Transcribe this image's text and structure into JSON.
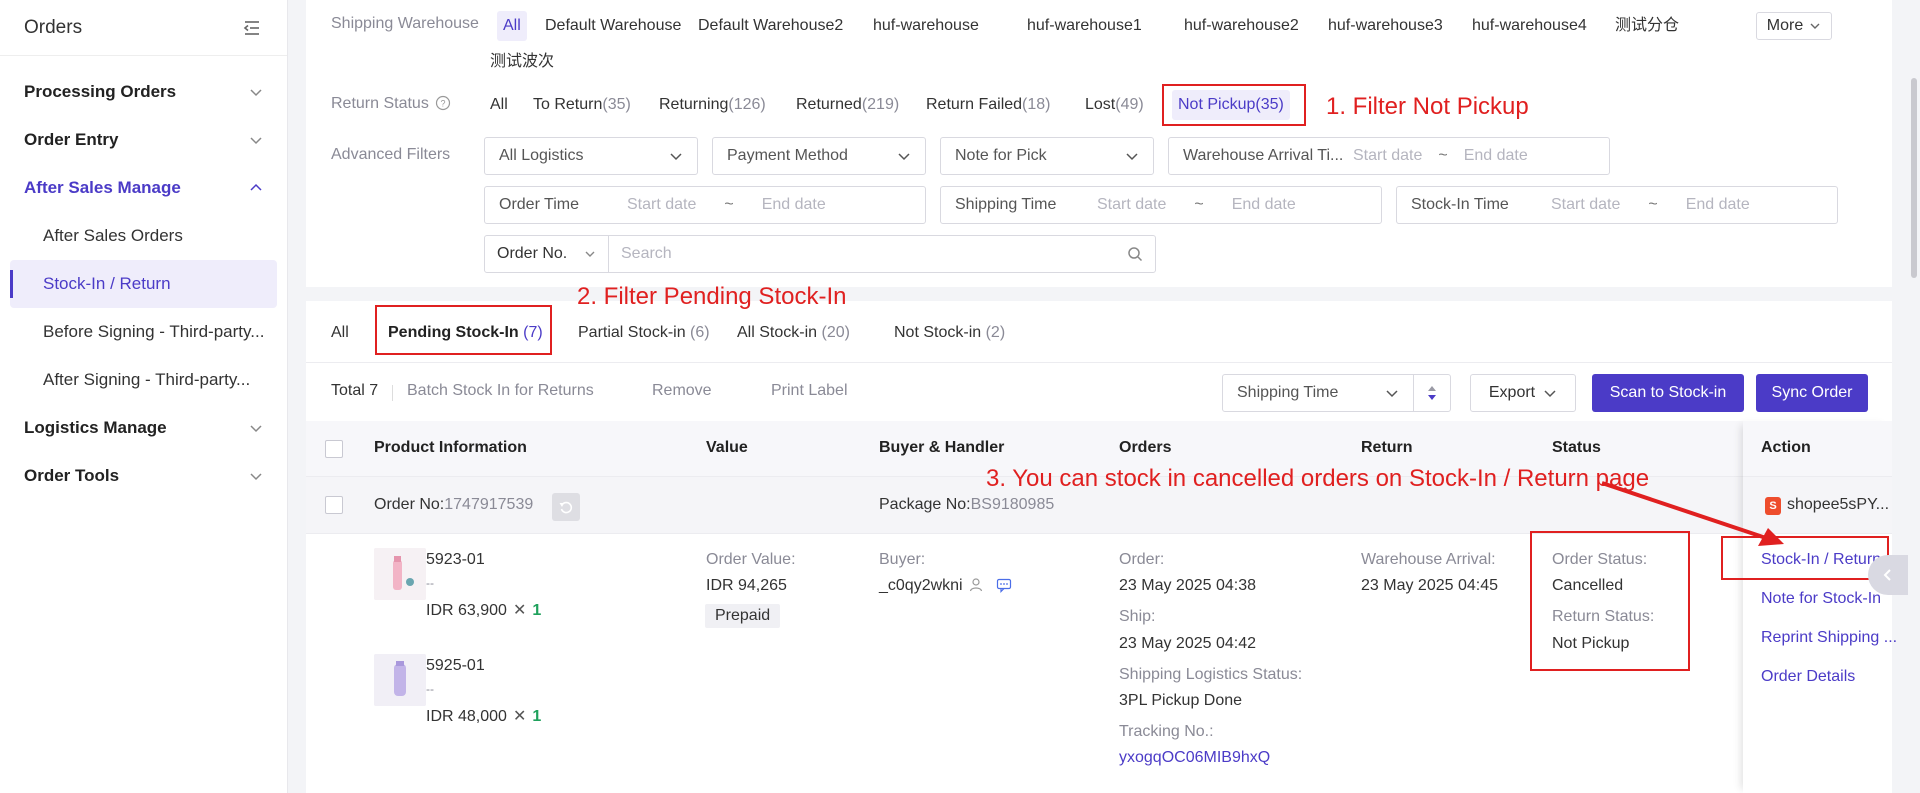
{
  "sidebar": {
    "title": "Orders",
    "groups": [
      {
        "label": "Processing Orders"
      },
      {
        "label": "Order Entry"
      },
      {
        "label": "After Sales Manage"
      },
      {
        "label": "Logistics Manage"
      },
      {
        "label": "Order Tools"
      }
    ],
    "subitems": [
      {
        "label": "After Sales Orders"
      },
      {
        "label": "Stock-In / Return"
      },
      {
        "label": "Before Signing - Third-party..."
      },
      {
        "label": "After Signing - Third-party..."
      }
    ]
  },
  "filters": {
    "warehouse_label": "Shipping Warehouse",
    "warehouses": [
      "All",
      "Default Warehouse",
      "Default Warehouse2",
      "huf-warehouse",
      "huf-warehouse1",
      "huf-warehouse2",
      "huf-warehouse3",
      "huf-warehouse4",
      "测试分仓",
      "测试波次"
    ],
    "more_label": "More",
    "return_status_label": "Return Status",
    "return_statuses": [
      {
        "label": "All",
        "count": ""
      },
      {
        "label": "To Return",
        "count": "(35)"
      },
      {
        "label": "Returning",
        "count": "(126)"
      },
      {
        "label": "Returned",
        "count": "(219)"
      },
      {
        "label": "Return Failed",
        "count": "(18)"
      },
      {
        "label": "Lost",
        "count": "(49)"
      },
      {
        "label": "Not Pickup",
        "count": "(35)"
      }
    ],
    "advanced_label": "Advanced Filters",
    "selects": {
      "logistics": "All Logistics",
      "payment": "Payment Method",
      "note": "Note for Pick"
    },
    "ranges": {
      "warehouse_arrival": "Warehouse Arrival Ti...",
      "order_time": "Order Time",
      "shipping_time": "Shipping Time",
      "stock_in_time": "Stock-In Time",
      "start_placeholder": "Start date",
      "end_placeholder": "End date",
      "separator": "~"
    },
    "search": {
      "type": "Order No.",
      "placeholder": "Search"
    }
  },
  "tabs": [
    {
      "label": "All",
      "count": ""
    },
    {
      "label": "Pending Stock-In",
      "count": "(7)"
    },
    {
      "label": "Partial Stock-in",
      "count": "(6)"
    },
    {
      "label": "All Stock-in",
      "count": "(20)"
    },
    {
      "label": "Not Stock-in",
      "count": "(2)"
    }
  ],
  "toolbar": {
    "total": "Total 7",
    "batch_stock_in": "Batch Stock In for Returns",
    "remove": "Remove",
    "print_label": "Print Label",
    "sort_field": "Shipping Time",
    "export": "Export",
    "scan": "Scan to Stock-in",
    "sync": "Sync Order"
  },
  "columns": {
    "product": "Product Information",
    "value": "Value",
    "buyer": "Buyer & Handler",
    "orders": "Orders",
    "return": "Return",
    "status": "Status",
    "action": "Action"
  },
  "order": {
    "order_no_label": "Order No:",
    "order_no": "1747917539",
    "package_label": "Package No:",
    "package_no": "BS9180985",
    "shop": "shopee5sPY...",
    "products": [
      {
        "sku": "5923-01",
        "sub": "--",
        "price": "IDR 63,900",
        "qty": "1"
      },
      {
        "sku": "5925-01",
        "sub": "--",
        "price": "IDR 48,000",
        "qty": "1"
      }
    ],
    "order_value_label": "Order Value:",
    "order_value": "IDR 94,265",
    "payment_badge": "Prepaid",
    "buyer_label": "Buyer:",
    "buyer": "_c0qy2wkni",
    "order_label": "Order:",
    "order_time": "23 May 2025 04:38",
    "ship_label": "Ship:",
    "ship_time": "23 May 2025 04:42",
    "logistics_status_label": "Shipping Logistics Status:",
    "logistics_status": "3PL Pickup Done",
    "tracking_label": "Tracking No.:",
    "tracking_no": "yxogqOC06MIB9hxQ",
    "warehouse_arrival_label": "Warehouse Arrival:",
    "warehouse_arrival": "23 May 2025 04:45",
    "order_status_label": "Order Status:",
    "order_status": "Cancelled",
    "return_status_label": "Return Status:",
    "return_status": "Not Pickup",
    "actions": [
      "Stock-In / Return",
      "Note for Stock-In",
      "Reprint Shipping ...",
      "Order Details"
    ]
  },
  "annotations": {
    "step1": "1. Filter Not Pickup",
    "step2": "2. Filter Pending Stock-In",
    "step3": "3. You can stock in cancelled orders on Stock-In / Return page"
  },
  "colors": {
    "accent": "#4b3bc7",
    "annotation": "#e02020",
    "quantity": "#1fa15c"
  }
}
